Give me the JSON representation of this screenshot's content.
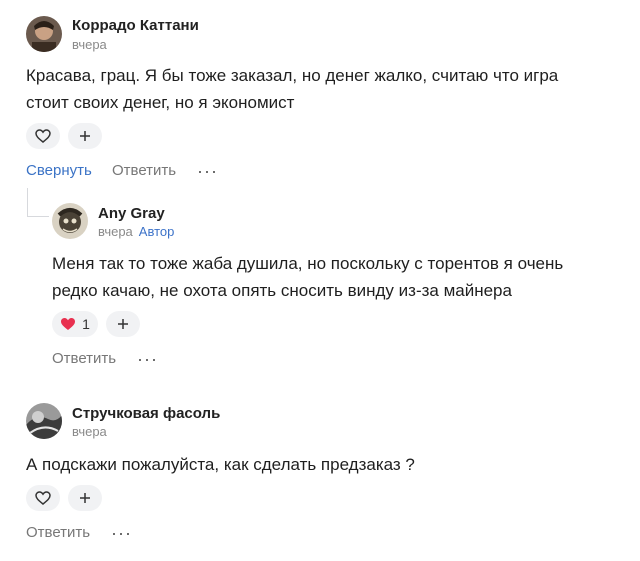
{
  "comments": [
    {
      "author": "Коррадо Каттани",
      "time": "вчера",
      "text_line1": "Красава, грац. Я бы тоже заказал, но денег жалко, считаю что игра",
      "text_line2": "стоит своих денег, но я экономист",
      "like_count": "",
      "actions": {
        "collapse": "Свернуть",
        "reply": "Ответить",
        "more": "···"
      },
      "reply": {
        "author": "Any Gray",
        "time": "вчера",
        "badge": "Автор",
        "text_line1": "Меня так то тоже жаба душила, но поскольку с торентов я очень",
        "text_line2": "редко качаю, не охота опять сносить винду из-за майнера",
        "like_count": "1",
        "actions": {
          "reply": "Ответить",
          "more": "···"
        }
      }
    },
    {
      "author": "Стручковая фасоль",
      "time": "вчера",
      "text_line1": "А подскажи пожалуйста, как сделать предзаказ ?",
      "actions": {
        "reply": "Ответить",
        "more": "···"
      }
    }
  ],
  "colors": {
    "link": "#3b73c6",
    "liked_heart": "#e8304f",
    "pill_bg": "#f1f2f4"
  }
}
